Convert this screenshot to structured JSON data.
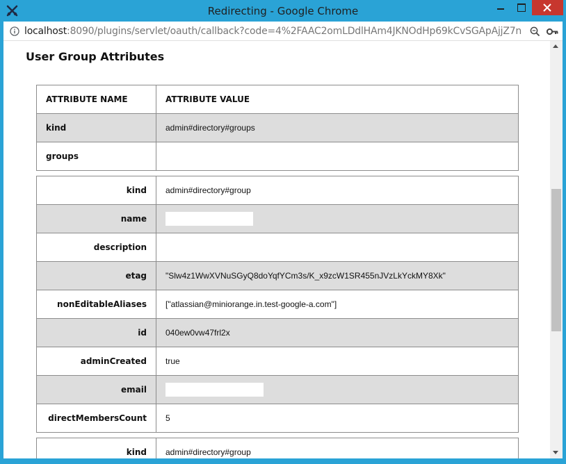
{
  "window": {
    "title": "Redirecting - Google Chrome"
  },
  "address_bar": {
    "host": "localhost",
    "url_rest": ":8090/plugins/servlet/oauth/callback?code=4%2FAAC2omLDdlHAm4JKNOdHp69kCvSGApAjjZ7nWnGWl..."
  },
  "page": {
    "heading": "User Group Attributes",
    "header_table": {
      "col_name": "ATTRIBUTE NAME",
      "col_value": "ATTRIBUTE VALUE",
      "rows": [
        {
          "name": "kind",
          "value": "admin#directory#groups"
        },
        {
          "name": "groups",
          "value": ""
        }
      ]
    },
    "group1": [
      {
        "name": "kind",
        "value": "admin#directory#group"
      },
      {
        "name": "name",
        "value": ""
      },
      {
        "name": "description",
        "value": ""
      },
      {
        "name": "etag",
        "value": "\"Slw4z1WwXVNuSGyQ8doYqfYCm3s/K_x9zcW1SR455nJVzLkYckMY8Xk\""
      },
      {
        "name": "nonEditableAliases",
        "value": "[\"atlassian@miniorange.in.test-google-a.com\"]"
      },
      {
        "name": "id",
        "value": "040ew0vw47frl2x"
      },
      {
        "name": "adminCreated",
        "value": "true"
      },
      {
        "name": "email",
        "value": ""
      },
      {
        "name": "directMembersCount",
        "value": "5"
      }
    ],
    "group2": [
      {
        "name": "kind",
        "value": "admin#directory#group"
      }
    ]
  }
}
